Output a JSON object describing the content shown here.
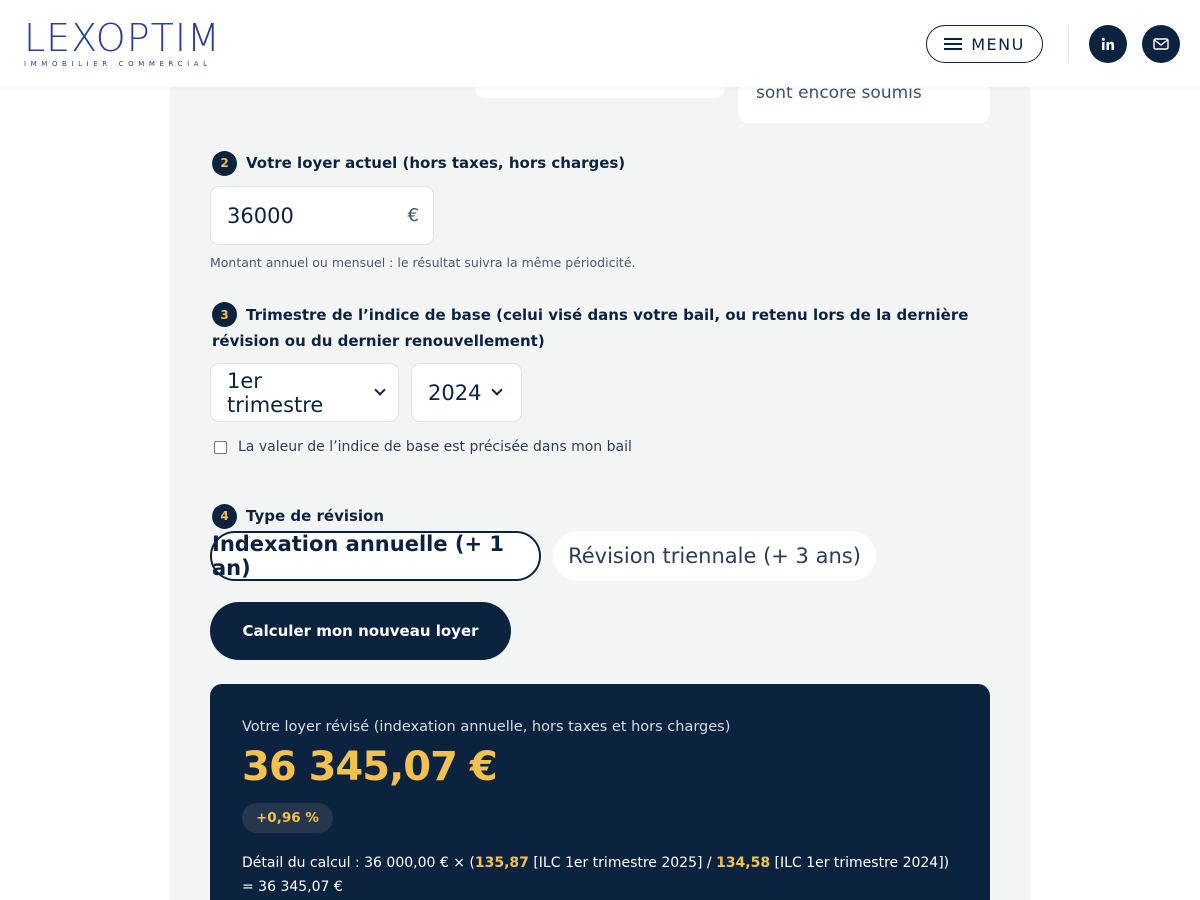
{
  "header": {
    "logo_main": "LEXOPTIM",
    "logo_sub": "IMMOBILIER COMMERCIAL",
    "menu_label": "MENU",
    "icons": [
      "menu-icon",
      "linkedin-icon",
      "mail-icon"
    ]
  },
  "previous": {
    "partial_text": "sont encore soumis"
  },
  "step2": {
    "number": "2",
    "title": "Votre loyer actuel (hors taxes, hors charges)",
    "value": "36000",
    "unit": "€",
    "hint": "Montant annuel ou mensuel : le résultat suivra la même périodicité."
  },
  "step3": {
    "number": "3",
    "title": "Trimestre de l’indice de base (celui visé dans votre bail, ou retenu lors de la dernière révision ou du dernier renouvellement)",
    "quarter": "1er trimestre",
    "year": "2024",
    "checkbox_label": "La valeur de l’indice de base est précisée dans mon bail",
    "checkbox_checked": false
  },
  "step4": {
    "number": "4",
    "title": "Type de révision",
    "option_active": "Indexation annuelle (+ 1 an)",
    "option_inactive": "Révision triennale (+ 3 ans)"
  },
  "calc_button": "Calculer mon nouveau loyer",
  "result": {
    "label": "Votre loyer révisé (indexation annuelle, hors taxes et hors charges)",
    "amount": "36 345,07 €",
    "change": "+0,96 %",
    "detail_prefix": "Détail du calcul : 36 000,00 € × (",
    "index_new": "135,87",
    "index_new_label": " [ILC 1er trimestre 2025] / ",
    "index_base": "134,58",
    "index_base_label": " [ILC 1er trimestre 2024])",
    "detail_result": "= 36 345,07 €"
  },
  "colors": {
    "navy": "#0c2340",
    "gold": "#f2c14e",
    "logo_blue": "#2c3f8f",
    "card_bg": "#f3f5f4"
  }
}
